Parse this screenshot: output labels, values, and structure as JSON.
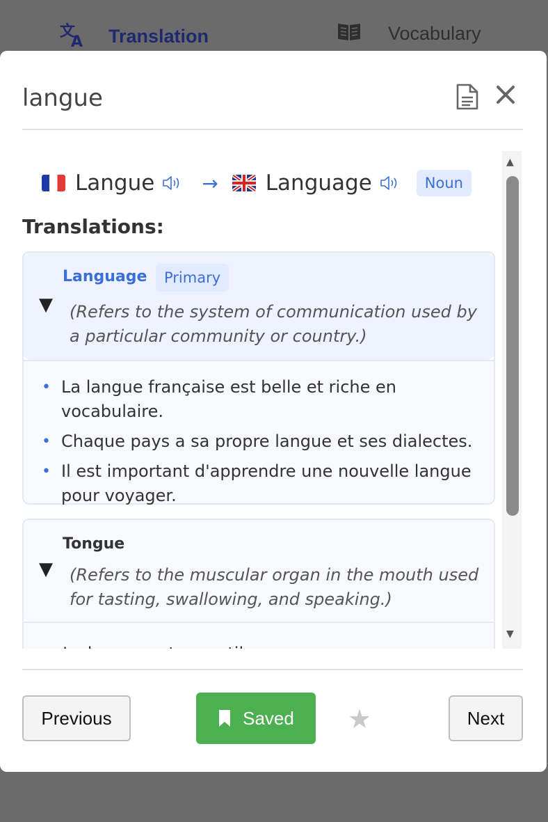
{
  "background_nav": {
    "tabs": [
      {
        "label": "Translation",
        "icon": "translate-icon",
        "active": true
      },
      {
        "label": "Vocabulary",
        "icon": "book-icon",
        "active": false
      }
    ]
  },
  "modal": {
    "title": "langue",
    "source_word": "Langue",
    "target_word": "Language",
    "arrow": "→",
    "part_of_speech": "Noun",
    "translations_label": "Translations:",
    "translations": [
      {
        "title": "Language",
        "badge": "Primary",
        "description": "(Refers to the system of communication used by a particular community or country.)",
        "examples": [
          "La langue française est belle et riche en vocabulaire.",
          "Chaque pays a sa propre langue et ses dialectes.",
          "Il est important d'apprendre une nouvelle langue pour voyager."
        ]
      },
      {
        "title": "Tongue",
        "description": "(Refers to the muscular organ in the mouth used for tasting, swallowing, and speaking.)",
        "clipped_example": "La langue est un outil"
      }
    ],
    "footer": {
      "previous_label": "Previous",
      "saved_label": "Saved",
      "next_label": "Next"
    }
  },
  "colors": {
    "accent": "#3a6fd8",
    "saved_green": "#4cb050",
    "overlay": "#6b6b6b"
  }
}
